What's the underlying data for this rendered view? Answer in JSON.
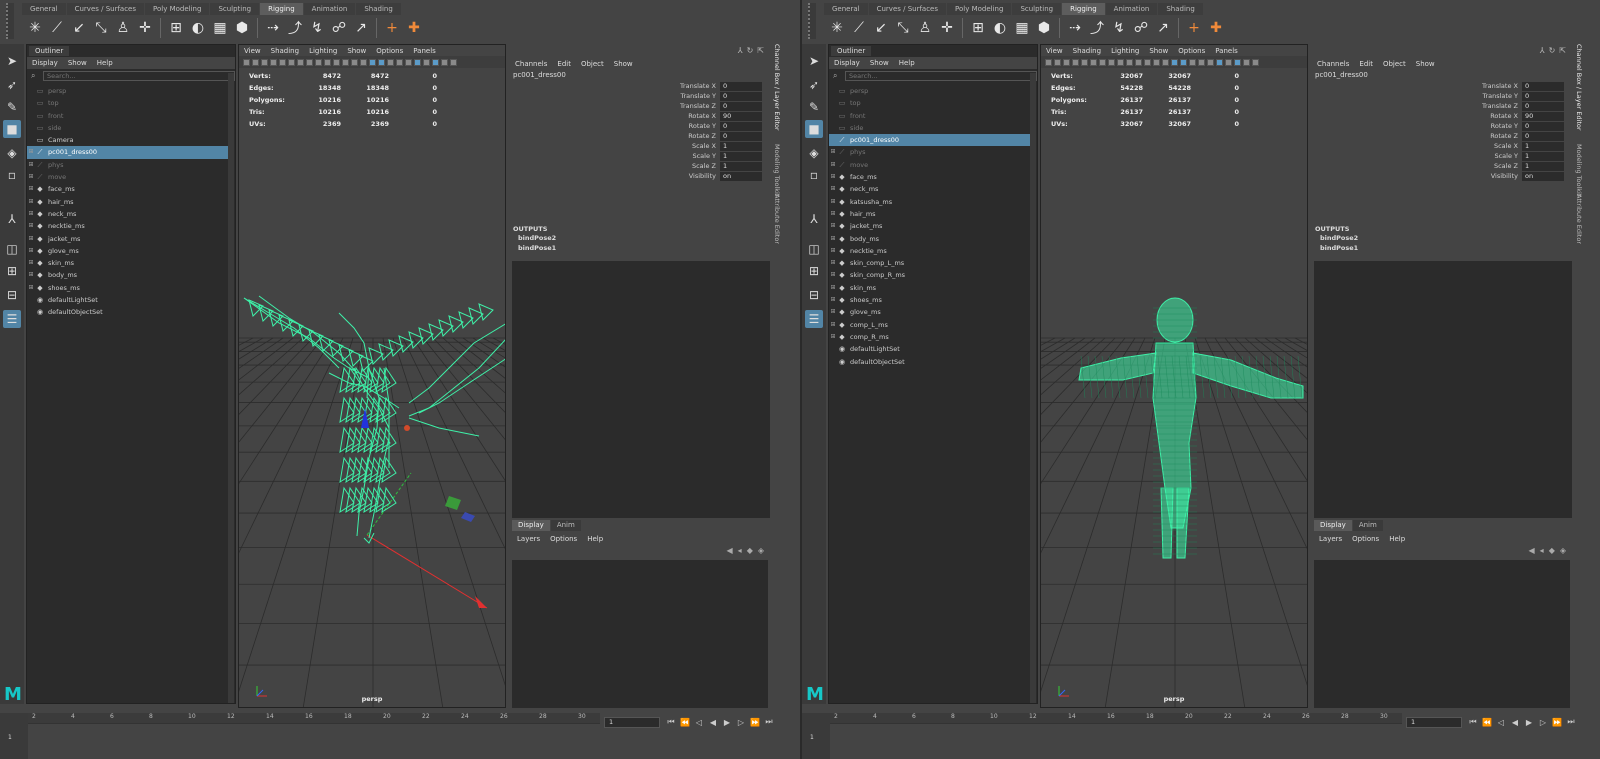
{
  "shelf_tabs": [
    "General",
    "Curves / Surfaces",
    "Poly Modeling",
    "Sculpting",
    "Rigging",
    "Animation",
    "Shading"
  ],
  "shelf_active_tab": "Rigging",
  "outliner": {
    "title": "Outliner",
    "menu": [
      "Display",
      "Show",
      "Help"
    ],
    "search_placeholder": "Search..."
  },
  "viewport_menu": [
    "View",
    "Shading",
    "Lighting",
    "Show",
    "Options",
    "Panels"
  ],
  "hud_labels": [
    "Verts:",
    "Edges:",
    "Polygons:",
    "Tris:",
    "UVs:"
  ],
  "camera_label": "persp",
  "channel_box": {
    "menu": [
      "Channels",
      "Edit",
      "Object",
      "Show"
    ],
    "object_name": "pc001_dress00",
    "attributes": [
      {
        "label": "Translate X",
        "value": "0"
      },
      {
        "label": "Translate Y",
        "value": "0"
      },
      {
        "label": "Translate Z",
        "value": "0"
      },
      {
        "label": "Rotate X",
        "value": "90"
      },
      {
        "label": "Rotate Y",
        "value": "0"
      },
      {
        "label": "Rotate Z",
        "value": "0"
      },
      {
        "label": "Scale X",
        "value": "1"
      },
      {
        "label": "Scale Y",
        "value": "1"
      },
      {
        "label": "Scale Z",
        "value": "1"
      },
      {
        "label": "Visibility",
        "value": "on"
      }
    ],
    "outputs_label": "OUTPUTS",
    "outputs": [
      "bindPose2",
      "bindPose1"
    ]
  },
  "layer_editor": {
    "tabs": [
      "Display",
      "Anim"
    ],
    "menu": [
      "Layers",
      "Options",
      "Help"
    ]
  },
  "side_tabs": [
    "Channel Box / Layer Editor",
    "Modeling Toolkit",
    "Attribute Editor"
  ],
  "timeline": {
    "ticks": [
      "2",
      "4",
      "6",
      "8",
      "10",
      "12",
      "14",
      "16",
      "18",
      "20",
      "22",
      "24",
      "26",
      "28",
      "30"
    ],
    "start": "1",
    "current_frame": "1"
  },
  "left": {
    "hud": {
      "verts": [
        "8472",
        "8472",
        "0"
      ],
      "edges": [
        "18348",
        "18348",
        "0"
      ],
      "polygons": [
        "10216",
        "10216",
        "0"
      ],
      "tris": [
        "10216",
        "10216",
        "0"
      ],
      "uvs": [
        "2369",
        "2369",
        "0"
      ]
    },
    "outliner_items": [
      {
        "name": "persp",
        "icon": "camera-icon",
        "dim": true,
        "expand": ""
      },
      {
        "name": "top",
        "icon": "camera-icon",
        "dim": true,
        "expand": ""
      },
      {
        "name": "front",
        "icon": "camera-icon",
        "dim": true,
        "expand": ""
      },
      {
        "name": "side",
        "icon": "camera-icon",
        "dim": true,
        "expand": ""
      },
      {
        "name": "Camera",
        "icon": "camera-icon",
        "dim": false,
        "expand": ""
      },
      {
        "name": "pc001_dress00",
        "icon": "joint-icon",
        "dim": false,
        "expand": "+",
        "selected": true
      },
      {
        "name": "phys",
        "icon": "joint-icon",
        "dim": true,
        "expand": "+"
      },
      {
        "name": "move",
        "icon": "joint-icon",
        "dim": true,
        "expand": "+"
      },
      {
        "name": "face_ms",
        "icon": "mesh-icon",
        "dim": false,
        "expand": "+"
      },
      {
        "name": "hair_ms",
        "icon": "mesh-icon",
        "dim": false,
        "expand": "+"
      },
      {
        "name": "neck_ms",
        "icon": "mesh-icon",
        "dim": false,
        "expand": "+"
      },
      {
        "name": "necktie_ms",
        "icon": "mesh-icon",
        "dim": false,
        "expand": "+"
      },
      {
        "name": "jacket_ms",
        "icon": "mesh-icon",
        "dim": false,
        "expand": "+"
      },
      {
        "name": "glove_ms",
        "icon": "mesh-icon",
        "dim": false,
        "expand": "+"
      },
      {
        "name": "skin_ms",
        "icon": "mesh-icon",
        "dim": false,
        "expand": "+"
      },
      {
        "name": "body_ms",
        "icon": "mesh-icon",
        "dim": false,
        "expand": "+"
      },
      {
        "name": "shoes_ms",
        "icon": "mesh-icon",
        "dim": false,
        "expand": "+"
      },
      {
        "name": "defaultLightSet",
        "icon": "set-icon",
        "dim": false,
        "expand": ""
      },
      {
        "name": "defaultObjectSet",
        "icon": "set-icon",
        "dim": false,
        "expand": ""
      }
    ]
  },
  "right": {
    "hud": {
      "verts": [
        "32067",
        "32067",
        "0"
      ],
      "edges": [
        "54228",
        "54228",
        "0"
      ],
      "polygons": [
        "26137",
        "26137",
        "0"
      ],
      "tris": [
        "26137",
        "26137",
        "0"
      ],
      "uvs": [
        "32067",
        "32067",
        "0"
      ]
    },
    "outliner_items": [
      {
        "name": "persp",
        "icon": "camera-icon",
        "dim": true,
        "expand": ""
      },
      {
        "name": "top",
        "icon": "camera-icon",
        "dim": true,
        "expand": ""
      },
      {
        "name": "front",
        "icon": "camera-icon",
        "dim": true,
        "expand": ""
      },
      {
        "name": "side",
        "icon": "camera-icon",
        "dim": true,
        "expand": ""
      },
      {
        "name": "pc001_dress00",
        "icon": "joint-icon",
        "dim": false,
        "expand": "",
        "selected": true
      },
      {
        "name": "phys",
        "icon": "joint-icon",
        "dim": true,
        "expand": "+"
      },
      {
        "name": "move",
        "icon": "joint-icon",
        "dim": true,
        "expand": "+"
      },
      {
        "name": "face_ms",
        "icon": "mesh-icon",
        "dim": false,
        "expand": "+"
      },
      {
        "name": "neck_ms",
        "icon": "mesh-icon",
        "dim": false,
        "expand": "+"
      },
      {
        "name": "katsusha_ms",
        "icon": "mesh-icon",
        "dim": false,
        "expand": "+"
      },
      {
        "name": "hair_ms",
        "icon": "mesh-icon",
        "dim": false,
        "expand": "+"
      },
      {
        "name": "jacket_ms",
        "icon": "mesh-icon",
        "dim": false,
        "expand": "+"
      },
      {
        "name": "body_ms",
        "icon": "mesh-icon",
        "dim": false,
        "expand": "+"
      },
      {
        "name": "necktie_ms",
        "icon": "mesh-icon",
        "dim": false,
        "expand": "+"
      },
      {
        "name": "skin_comp_L_ms",
        "icon": "mesh-icon",
        "dim": false,
        "expand": "+"
      },
      {
        "name": "skin_comp_R_ms",
        "icon": "mesh-icon",
        "dim": false,
        "expand": "+"
      },
      {
        "name": "skin_ms",
        "icon": "mesh-icon",
        "dim": false,
        "expand": "+"
      },
      {
        "name": "shoes_ms",
        "icon": "mesh-icon",
        "dim": false,
        "expand": "+"
      },
      {
        "name": "glove_ms",
        "icon": "mesh-icon",
        "dim": false,
        "expand": "+"
      },
      {
        "name": "comp_L_ms",
        "icon": "mesh-icon",
        "dim": false,
        "expand": "+"
      },
      {
        "name": "comp_R_ms",
        "icon": "mesh-icon",
        "dim": false,
        "expand": "+"
      },
      {
        "name": "defaultLightSet",
        "icon": "set-icon",
        "dim": false,
        "expand": ""
      },
      {
        "name": "defaultObjectSet",
        "icon": "set-icon",
        "dim": false,
        "expand": ""
      }
    ]
  },
  "colors": {
    "selection": "#5285a6",
    "wireframe": "#3ef0a8",
    "maya_logo": "#16c8c8"
  }
}
